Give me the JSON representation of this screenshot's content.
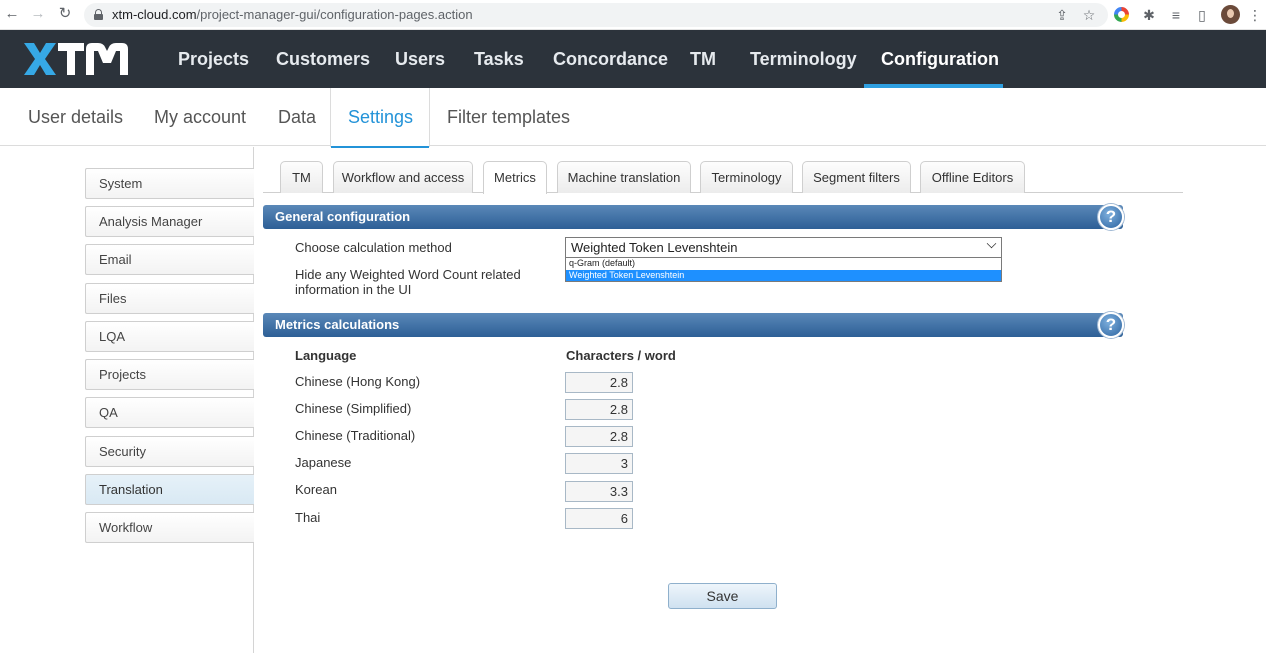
{
  "browser": {
    "url_host": "xtm-cloud.com",
    "url_path": "/project-manager-gui/configuration-pages.action"
  },
  "topnav": {
    "logo_text": "XTM",
    "items": [
      "Projects",
      "Customers",
      "Users",
      "Tasks",
      "Concordance",
      "TM",
      "Terminology",
      "Configuration"
    ],
    "active": "Configuration",
    "accent_color": "#2e9fe0"
  },
  "subnav": {
    "items": [
      "User details",
      "My account",
      "Data",
      "Settings",
      "Filter templates"
    ],
    "active": "Settings"
  },
  "sidebar": {
    "items": [
      "System",
      "Analysis Manager",
      "Email",
      "Files",
      "LQA",
      "Projects",
      "QA",
      "Security",
      "Translation",
      "Workflow"
    ],
    "active": "Translation"
  },
  "tabs": {
    "items": [
      "TM",
      "Workflow and access",
      "Metrics",
      "Machine translation",
      "Terminology",
      "Segment filters",
      "Offline Editors"
    ],
    "active": "Metrics"
  },
  "general": {
    "header": "General configuration",
    "calc_label": "Choose calculation method",
    "calc_value": "Weighted Token Levenshtein",
    "calc_options": [
      "q-Gram (default)",
      "Weighted Token Levenshtein"
    ],
    "hide_label_line1": "Hide any Weighted Word Count related",
    "hide_label_line2": "information in the UI"
  },
  "metrics": {
    "header": "Metrics calculations",
    "col_language": "Language",
    "col_chars": "Characters / word",
    "rows": [
      {
        "language": "Chinese (Hong Kong)",
        "value": "2.8"
      },
      {
        "language": "Chinese (Simplified)",
        "value": "2.8"
      },
      {
        "language": "Chinese (Traditional)",
        "value": "2.8"
      },
      {
        "language": "Japanese",
        "value": "3"
      },
      {
        "language": "Korean",
        "value": "3.3"
      },
      {
        "language": "Thai",
        "value": "6"
      }
    ]
  },
  "help_glyph": "?",
  "save_label": "Save"
}
